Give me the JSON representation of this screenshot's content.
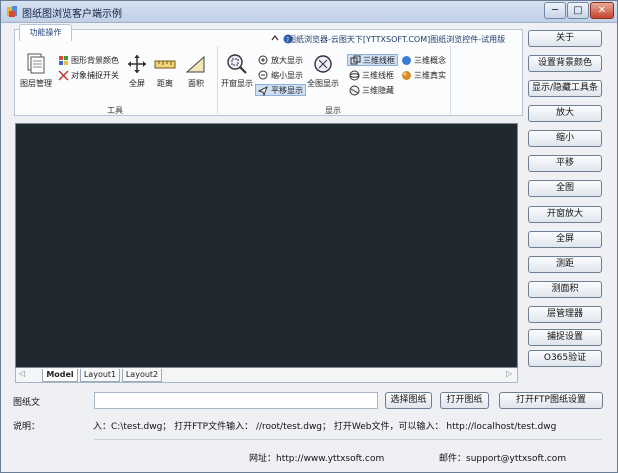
{
  "window": {
    "title": "图纸图浏览客户端示例",
    "controls": {
      "minimize": "─",
      "maximize": "□",
      "close": "✕"
    }
  },
  "ribbon": {
    "tab_label": "功能操作",
    "caption": "图纸浏览器-云图天下[YTTXSOFT.COM]图纸浏览控件-试用版",
    "groups": {
      "tools": {
        "label": "工具",
        "layer_manager": "图层管理",
        "bg_color": "图形背景颜色",
        "snap_toggle": "对象捕捉开关",
        "fullscreen": "全屏",
        "distance": "距离",
        "area": "面积"
      },
      "display": {
        "label": "显示",
        "open_window": "开窗显示",
        "zoom_in": "放大显示",
        "zoom_out": "缩小显示",
        "pan": "平移显示",
        "full_view": "全图显示",
        "wireframe3d_a": "三维线框",
        "wireframe3d_b": "三维线框",
        "hidden3d": "三维隐藏",
        "concept3d": "三维概念",
        "realistic3d": "三维真实"
      }
    }
  },
  "layout_tabs": [
    "Model",
    "Layout1",
    "Layout2"
  ],
  "sidebar_buttons": [
    "关于",
    "设置背景颜色",
    "显示/隐藏工具条",
    "放大",
    "缩小",
    "平移",
    "全图",
    "开窗放大",
    "全屏",
    "测距",
    "测面积",
    "层管理器",
    "捕捉设置",
    "O365验证"
  ],
  "file_row": {
    "label": "图纸文",
    "value": "",
    "select_button": "选择图纸",
    "open_button": "打开图纸",
    "ftp_settings_button": "打开FTP图纸设置"
  },
  "description": {
    "label": "说明：",
    "text": "入：C:\\test.dwg；  打开FTP文件输入：  //root/test.dwg；  打开Web文件，可以输入：  http://localhost/test.dwg"
  },
  "footer": {
    "website": "网址：http://www.yttxsoft.com",
    "email": "邮件：support@yttxsoft.com"
  },
  "colors": {
    "canvas_bg": "#212830",
    "title_text": "#102040",
    "ribbon_caption": "#1f3b6d"
  }
}
